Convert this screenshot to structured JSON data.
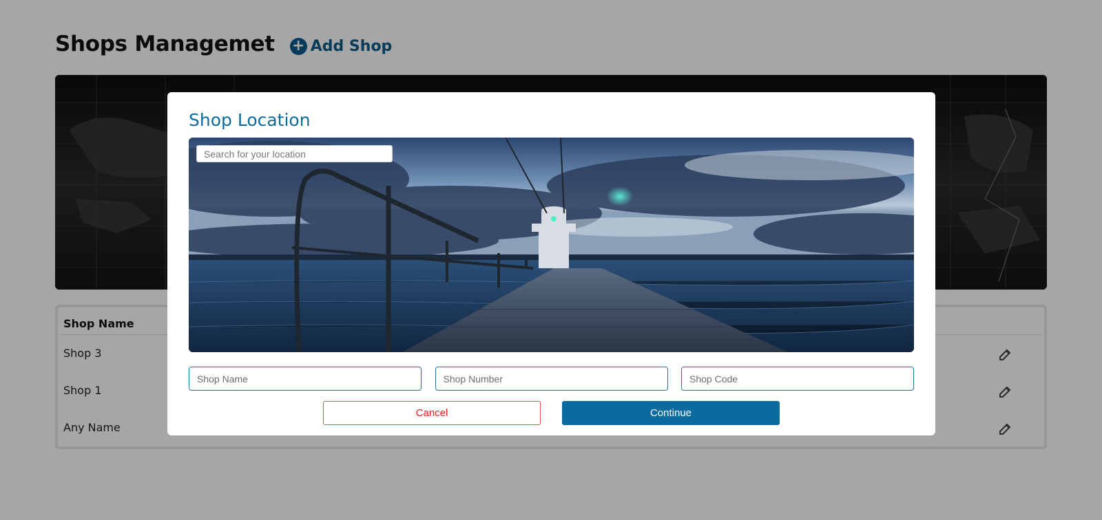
{
  "header": {
    "title": "Shops Managemet",
    "add_label": "Add Shop"
  },
  "table": {
    "header": "Shop Name",
    "rows": [
      {
        "name": "Shop 3"
      },
      {
        "name": "Shop 1"
      },
      {
        "name": "Any Name"
      }
    ]
  },
  "modal": {
    "title": "Shop Location",
    "search_placeholder": "Search for your location",
    "fields": {
      "shop_name_placeholder": "Shop Name",
      "shop_number_placeholder": "Shop Number",
      "shop_code_placeholder": "Shop Code"
    },
    "cancel_label": "Cancel",
    "continue_label": "Continue"
  },
  "colors": {
    "accent": "#0a6b9e",
    "cancel": "#e02020",
    "overlay": "rgba(0,0,0,0.35)"
  },
  "icons": {
    "add": "plus-circle-icon",
    "edit": "edit-icon"
  }
}
